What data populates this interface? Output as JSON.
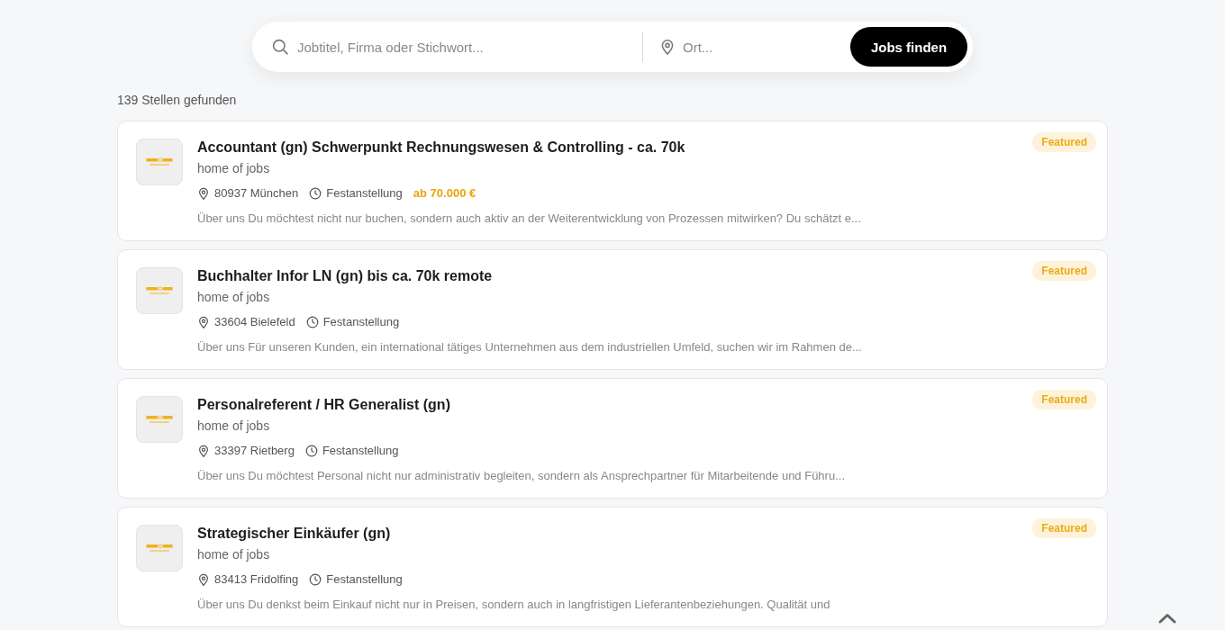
{
  "search": {
    "query_placeholder": "Jobtitel, Firma oder Stichwort...",
    "location_placeholder": "Ort...",
    "button": "Jobs finden"
  },
  "result_count": "139 Stellen gefunden",
  "jobs": [
    {
      "title": "Accountant (gn) Schwerpunkt Rechnungswesen & Controlling - ca. 70k",
      "company": "home of jobs",
      "location": "80937 München",
      "employment_type": "Festanstellung",
      "salary": "ab 70.000 €",
      "description": "Über uns Du möchtest nicht nur buchen, sondern auch aktiv an der Weiterentwicklung von Prozessen mitwirken? Du schätzt e...",
      "badge": "Featured"
    },
    {
      "title": "Buchhalter Infor LN (gn) bis ca. 70k remote",
      "company": "home of jobs",
      "location": "33604 Bielefeld",
      "employment_type": "Festanstellung",
      "description": "Über uns Für unseren Kunden, ein international tätiges Unternehmen aus dem industriellen Umfeld, suchen wir im Rahmen de...",
      "badge": "Featured"
    },
    {
      "title": "Personalreferent / HR Generalist (gn)",
      "company": "home of jobs",
      "location": "33397 Rietberg",
      "employment_type": "Festanstellung",
      "description": "Über uns Du möchtest Personal nicht nur administrativ begleiten, sondern als Ansprechpartner für Mitarbeitende und Führu...",
      "badge": "Featured"
    },
    {
      "title": "Strategischer Einkäufer (gn)",
      "company": "home of jobs",
      "location": "83413 Fridolfing",
      "employment_type": "Festanstellung",
      "description": "Über uns Du denkst beim Einkauf nicht nur in Preisen, sondern auch in langfristigen Lieferantenbeziehungen. Qualität und",
      "badge": "Featured"
    }
  ]
}
